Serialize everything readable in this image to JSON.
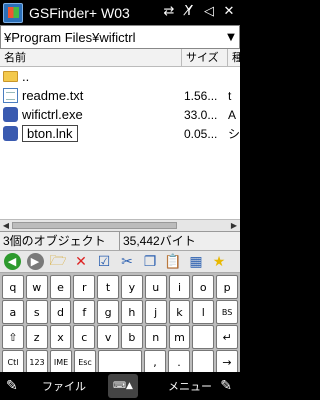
{
  "window": {
    "title": "GSFinder+ W03"
  },
  "status_icons": [
    "sync-icon",
    "signal-off-icon",
    "volume-off-icon",
    "close-icon"
  ],
  "path": {
    "value": "¥Program Files¥wifictrl"
  },
  "list": {
    "headers": {
      "name": "名前",
      "size": "サイズ",
      "type": "種"
    },
    "rows": [
      {
        "name": "..",
        "size": "",
        "type": "",
        "icon": "folder-icon"
      },
      {
        "name": "readme.txt",
        "size": "1.56...",
        "type": "t",
        "icon": "text-file-icon"
      },
      {
        "name": "wifictrl.exe",
        "size": "33.0...",
        "type": "A",
        "icon": "exe-icon"
      },
      {
        "name": "bton.lnk",
        "size": "0.05...",
        "type": "シ",
        "icon": "shortcut-icon"
      }
    ]
  },
  "status": {
    "count": "3個のオブジェクト",
    "bytes": "35,442バイト"
  },
  "keyboard": {
    "rows": [
      [
        "q",
        "w",
        "e",
        "r",
        "t",
        "y",
        "u",
        "i",
        "o",
        "p"
      ],
      [
        "a",
        "s",
        "d",
        "f",
        "g",
        "h",
        "j",
        "k",
        "l",
        "BS"
      ],
      [
        "⇧",
        "z",
        "x",
        "c",
        "v",
        "b",
        "n",
        "m",
        "",
        "↵"
      ],
      [
        "Ctl",
        "123",
        "IME",
        "Esc",
        "",
        "",
        ",",
        ".",
        "",
        "→"
      ]
    ]
  },
  "softkeys": {
    "left": "ファイル",
    "right": "メニュー"
  }
}
